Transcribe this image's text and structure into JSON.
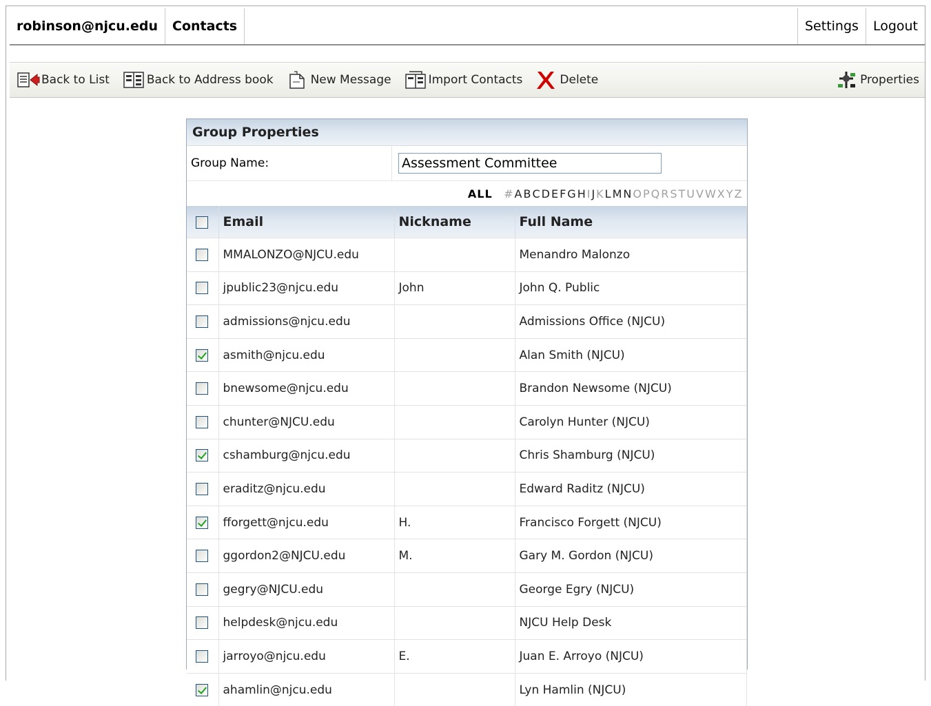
{
  "header": {
    "account": "robinson@njcu.edu",
    "section": "Contacts",
    "settings_label": "Settings",
    "logout_label": "Logout"
  },
  "toolbar": {
    "back_to_list": "Back to List",
    "back_to_address_book": "Back to Address book",
    "new_message": "New Message",
    "import_contacts": "Import Contacts",
    "delete": "Delete",
    "properties": "Properties"
  },
  "panel": {
    "title": "Group Properties",
    "group_name_label": "Group Name:",
    "group_name_value": "Assessment Committee"
  },
  "alphabet": {
    "all_label": "ALL",
    "letters": [
      {
        "ch": "#",
        "on": false
      },
      {
        "ch": "A",
        "on": true
      },
      {
        "ch": "B",
        "on": true
      },
      {
        "ch": "C",
        "on": true
      },
      {
        "ch": "D",
        "on": true
      },
      {
        "ch": "E",
        "on": true
      },
      {
        "ch": "F",
        "on": true
      },
      {
        "ch": "G",
        "on": true
      },
      {
        "ch": "H",
        "on": true
      },
      {
        "ch": "I",
        "on": false
      },
      {
        "ch": "J",
        "on": true
      },
      {
        "ch": "K",
        "on": false
      },
      {
        "ch": "L",
        "on": true
      },
      {
        "ch": "M",
        "on": true
      },
      {
        "ch": "N",
        "on": true
      },
      {
        "ch": "O",
        "on": false
      },
      {
        "ch": "P",
        "on": false
      },
      {
        "ch": "Q",
        "on": false
      },
      {
        "ch": "R",
        "on": false
      },
      {
        "ch": "S",
        "on": false
      },
      {
        "ch": "T",
        "on": false
      },
      {
        "ch": "U",
        "on": false
      },
      {
        "ch": "V",
        "on": false
      },
      {
        "ch": "W",
        "on": false
      },
      {
        "ch": "X",
        "on": false
      },
      {
        "ch": "Y",
        "on": false
      },
      {
        "ch": "Z",
        "on": false
      }
    ]
  },
  "table": {
    "columns": [
      "Email",
      "Nickname",
      "Full Name"
    ],
    "rows": [
      {
        "checked": false,
        "email": "MMALONZO@NJCU.edu",
        "nickname": "",
        "fullname": "Menandro Malonzo"
      },
      {
        "checked": false,
        "email": "jpublic23@njcu.edu",
        "nickname": "John",
        "fullname": "John Q. Public"
      },
      {
        "checked": false,
        "email": "admissions@njcu.edu",
        "nickname": "",
        "fullname": "Admissions Office (NJCU)"
      },
      {
        "checked": true,
        "email": "asmith@njcu.edu",
        "nickname": "",
        "fullname": "Alan Smith (NJCU)"
      },
      {
        "checked": false,
        "email": "bnewsome@njcu.edu",
        "nickname": "",
        "fullname": "Brandon Newsome (NJCU)"
      },
      {
        "checked": false,
        "email": "chunter@NJCU.edu",
        "nickname": "",
        "fullname": "Carolyn Hunter (NJCU)"
      },
      {
        "checked": true,
        "email": "cshamburg@njcu.edu",
        "nickname": "",
        "fullname": "Chris Shamburg (NJCU)"
      },
      {
        "checked": false,
        "email": "eraditz@njcu.edu",
        "nickname": "",
        "fullname": "Edward Raditz (NJCU)"
      },
      {
        "checked": true,
        "email": "fforgett@njcu.edu",
        "nickname": "H.",
        "fullname": "Francisco Forgett (NJCU)"
      },
      {
        "checked": false,
        "email": "ggordon2@NJCU.edu",
        "nickname": "M.",
        "fullname": "Gary M. Gordon (NJCU)"
      },
      {
        "checked": false,
        "email": "gegry@NJCU.edu",
        "nickname": "",
        "fullname": "George Egry (NJCU)"
      },
      {
        "checked": false,
        "email": "helpdesk@njcu.edu",
        "nickname": "",
        "fullname": "NJCU Help Desk"
      },
      {
        "checked": false,
        "email": "jarroyo@njcu.edu",
        "nickname": "E.",
        "fullname": "Juan E. Arroyo (NJCU)"
      },
      {
        "checked": true,
        "email": "ahamlin@njcu.edu",
        "nickname": "",
        "fullname": "Lyn Hamlin (NJCU)"
      }
    ]
  },
  "colors": {
    "header_gradient_top": "#c7d4e3",
    "checkbox_border": "#1c5180",
    "check_mark": "#21a121",
    "delete_red": "#d10000"
  },
  "icons": [
    "back-to-list-icon",
    "address-book-icon",
    "new-message-icon",
    "import-contacts-icon",
    "delete-icon",
    "properties-icon"
  ]
}
